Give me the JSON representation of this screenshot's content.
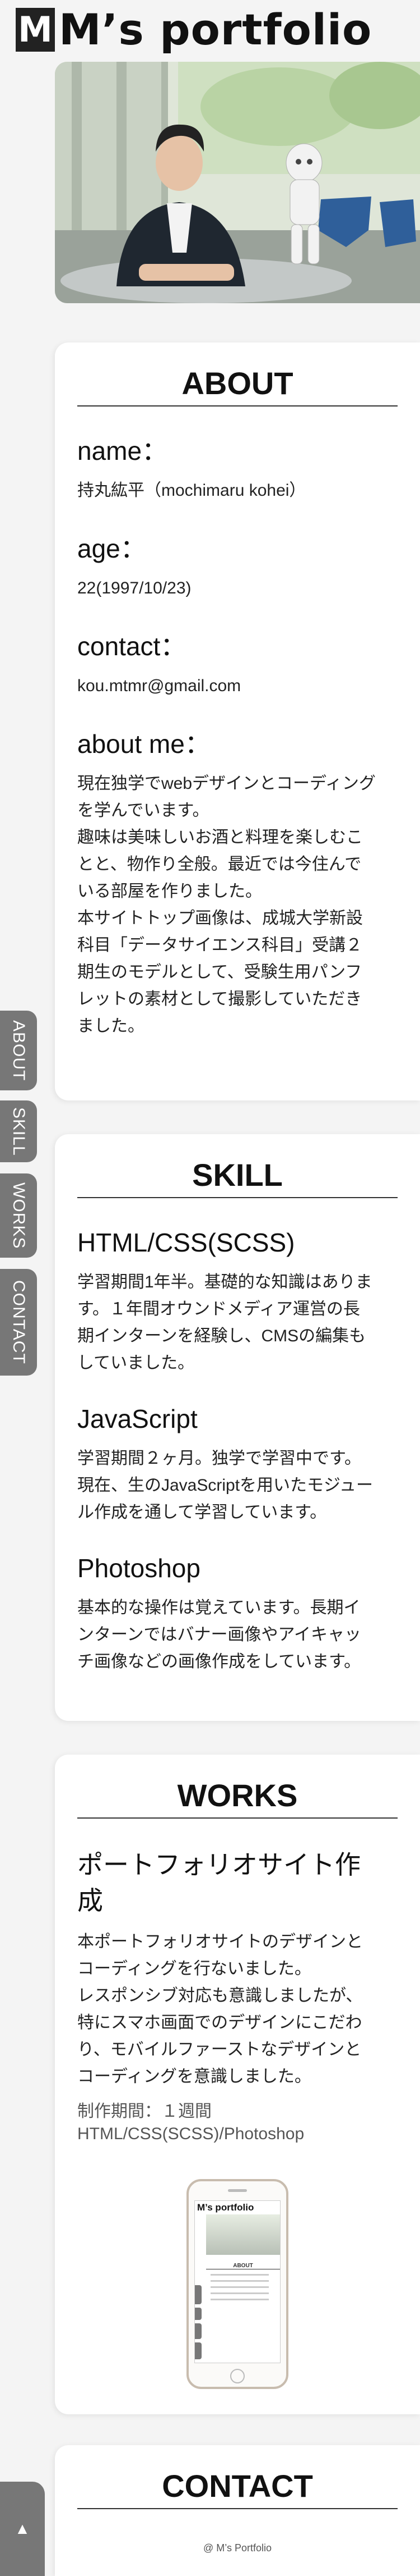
{
  "header": {
    "logo_mark": "M",
    "title": "M’s portfolio"
  },
  "side_nav": {
    "items": [
      {
        "label": "ABOUT"
      },
      {
        "label": "SKILL"
      },
      {
        "label": "WORKS"
      },
      {
        "label": "CONTACT"
      }
    ],
    "to_top_icon": "up-triangle-icon",
    "to_top_glyph": "▲"
  },
  "about": {
    "title": "ABOUT",
    "name_label": "name：",
    "name_value": "持丸紘平（mochimaru kohei）",
    "age_label": "age：",
    "age_value": "22(1997/10/23)",
    "contact_label": "contact：",
    "contact_value": "kou.mtmr@gmail.com",
    "about_me_label": "about me：",
    "about_me_text": "現在独学でwebデザインとコーディング\nを学んでいます。\n趣味は美味しいお酒と料理を楽しむこ\nとと、物作り全般。最近では今住んで\nいる部屋を作りました。\n本サイトトップ画像は、成城大学新設\n科目「データサイエンス科目」受講２\n期生のモデルとして、受験生用パンフ\nレットの素材として撮影していただき\nました。"
  },
  "skill": {
    "title": "SKILL",
    "items": [
      {
        "name": "HTML/CSS(SCSS)",
        "text": "学習期間1年半。基礎的な知識はありま\nす。１年間オウンドメディア運営の長\n期インターンを経験し、CMSの編集も\nしていました。"
      },
      {
        "name": "JavaScript",
        "text": "学習期間２ヶ月。独学で学習中です。\n現在、生のJavaScriptを用いたモジュー\nル作成を通して学習しています。"
      },
      {
        "name": "Photoshop",
        "text": "基本的な操作は覚えています。長期イ\nンターンではバナー画像やアイキャッ\nチ画像などの画像作成をしています。"
      }
    ]
  },
  "works": {
    "title": "WORKS",
    "work_title": "ポートフォリオサイト作\n成",
    "work_text": "本ポートフォリオサイトのデザインと\nコーディングを行ないました。\nレスポンシブ対応も意識しましたが、\n特にスマホ画面でのデザインにこだわ\nり、モバイルファーストなデザインと\nコーディングを意識しました。",
    "period": "制作期間：１週間",
    "tools": "HTML/CSS(SCSS)/Photoshop",
    "thumb": {
      "logo": "M’s portfolio",
      "section": "ABOUT"
    }
  },
  "contact": {
    "title": "CONTACT"
  },
  "footer": {
    "copyright": "@ M’s Portfolio"
  }
}
